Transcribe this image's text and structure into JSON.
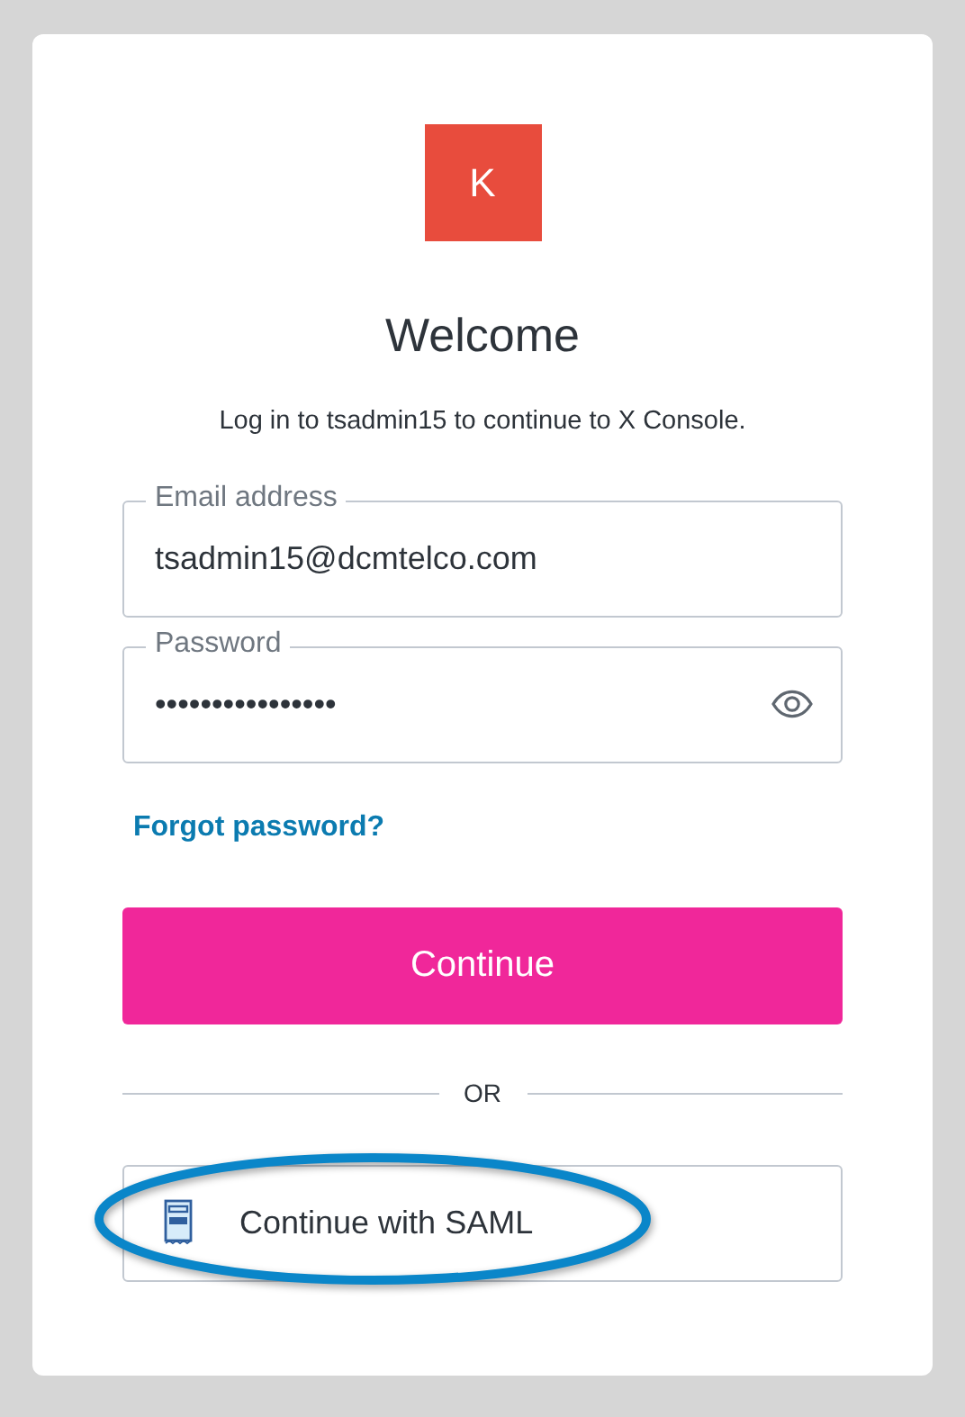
{
  "logo": {
    "letter": "K"
  },
  "title": "Welcome",
  "subtitle": "Log in to tsadmin15 to continue to X Console.",
  "fields": [
    {
      "kind": "text",
      "label": "Email address",
      "value": "tsadmin15@dcmtelco.com"
    },
    {
      "kind": "password",
      "label": "Password",
      "value": "••••••••••••••••"
    }
  ],
  "forgot_link": "Forgot password?",
  "continue_button": "Continue",
  "divider": "OR",
  "saml_button": {
    "label": "Continue with SAML"
  },
  "annotation": {
    "kind": "ellipse"
  }
}
